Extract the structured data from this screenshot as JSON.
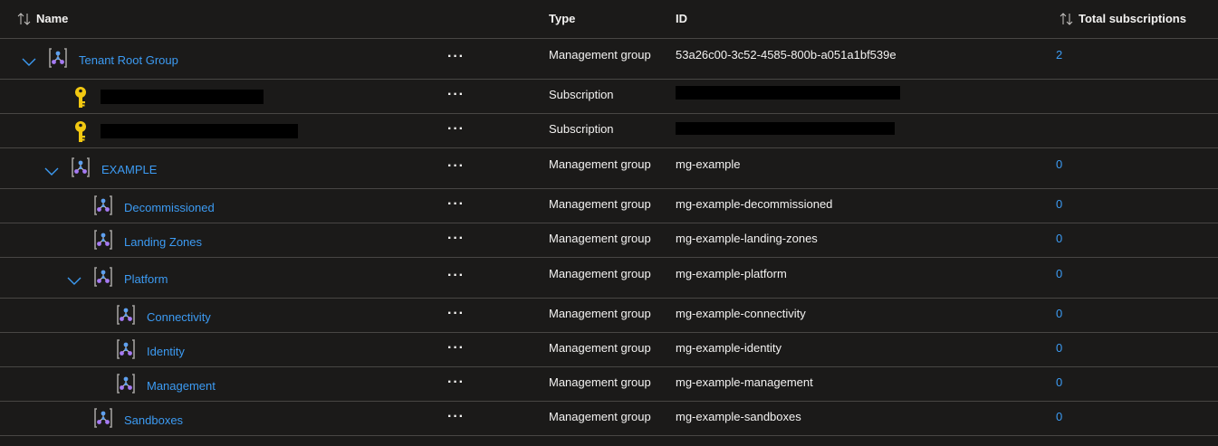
{
  "header": {
    "name_label": "Name",
    "type_label": "Type",
    "id_label": "ID",
    "total_label": "Total subscriptions"
  },
  "rows": [
    {
      "name": "Tenant Root Group",
      "type": "Management group",
      "id": "53a26c00-3c52-4585-800b-a051a1bf539e",
      "count": "2",
      "kind": "mg",
      "expanded": true,
      "depth": 0
    },
    {
      "name": "",
      "type": "Subscription",
      "id": "",
      "count": "",
      "kind": "sub",
      "redacted": true,
      "depth": 1
    },
    {
      "name": "",
      "type": "Subscription",
      "id": "",
      "count": "",
      "kind": "sub",
      "redacted": true,
      "depth": 1
    },
    {
      "name": "EXAMPLE",
      "type": "Management group",
      "id": "mg-example",
      "count": "0",
      "kind": "mg",
      "expanded": true,
      "depth": 1
    },
    {
      "name": "Decommissioned",
      "type": "Management group",
      "id": "mg-example-decommissioned",
      "count": "0",
      "kind": "mg",
      "depth": 2
    },
    {
      "name": "Landing Zones",
      "type": "Management group",
      "id": "mg-example-landing-zones",
      "count": "0",
      "kind": "mg",
      "depth": 2
    },
    {
      "name": "Platform",
      "type": "Management group",
      "id": "mg-example-platform",
      "count": "0",
      "kind": "mg",
      "expanded": true,
      "depth": 2
    },
    {
      "name": "Connectivity",
      "type": "Management group",
      "id": "mg-example-connectivity",
      "count": "0",
      "kind": "mg",
      "depth": 3
    },
    {
      "name": "Identity",
      "type": "Management group",
      "id": "mg-example-identity",
      "count": "0",
      "kind": "mg",
      "depth": 3
    },
    {
      "name": "Management",
      "type": "Management group",
      "id": "mg-example-management",
      "count": "0",
      "kind": "mg",
      "depth": 3
    },
    {
      "name": "Sandboxes",
      "type": "Management group",
      "id": "mg-example-sandboxes",
      "count": "0",
      "kind": "mg",
      "depth": 2
    }
  ],
  "icons": {
    "sort": "sort-icon",
    "chevron": "chevron-down-icon",
    "management_group": "management-group-icon",
    "subscription": "key-icon",
    "more": "more-icon"
  },
  "colors": {
    "background": "#1b1a19",
    "link": "#3c9bf3",
    "divider": "#484644",
    "key": "#f2c811"
  }
}
